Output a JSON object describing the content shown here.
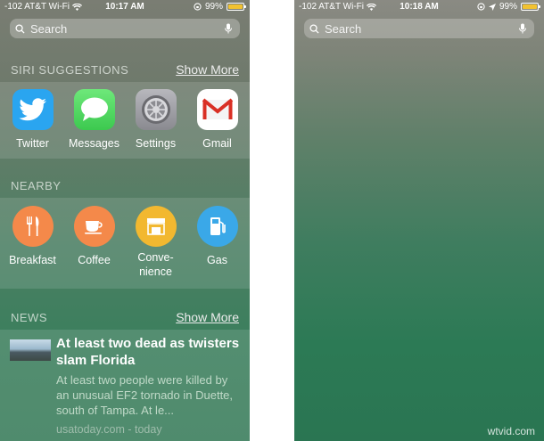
{
  "left_screen": {
    "status": {
      "carrier": "-102 AT&T Wi-Fi",
      "time": "10:17 AM",
      "battery": "99%",
      "battery_level": 0.99
    },
    "search": {
      "placeholder": "Search"
    },
    "siri_suggestions": {
      "title": "SIRI SUGGESTIONS",
      "show_more": "Show More",
      "apps": [
        {
          "label": "Twitter",
          "icon": "twitter-bird-icon",
          "color": "#2aa5f0"
        },
        {
          "label": "Messages",
          "icon": "messages-bubble-icon",
          "color": "#4cd964"
        },
        {
          "label": "Settings",
          "icon": "settings-gear-icon",
          "color": "#8e8e93"
        },
        {
          "label": "Gmail",
          "icon": "gmail-envelope-icon",
          "color": "#ffffff"
        }
      ]
    },
    "nearby": {
      "title": "NEARBY",
      "items": [
        {
          "label": "Breakfast",
          "icon": "fork-knife-icon",
          "color": "#f4894a"
        },
        {
          "label": "Coffee",
          "icon": "coffee-cup-icon",
          "color": "#f4894a"
        },
        {
          "label": "Conve-\nnience",
          "icon": "storefront-icon",
          "color": "#f2b830"
        },
        {
          "label": "Gas",
          "icon": "gas-pump-icon",
          "color": "#3aa8e8"
        }
      ]
    },
    "news": {
      "title": "NEWS",
      "show_more": "Show More",
      "headline": "At least two dead as twisters slam Florida",
      "summary": "At least two people were killed by an unusual EF2 tornado in Duette, south of Tampa. At le...",
      "source": "usatoday.com - today"
    }
  },
  "right_screen": {
    "status": {
      "carrier": "-102 AT&T Wi-Fi",
      "time": "10:18 AM",
      "battery": "99%",
      "battery_level": 0.99
    },
    "search": {
      "placeholder": "Search"
    }
  },
  "watermark": "wtvid.com"
}
